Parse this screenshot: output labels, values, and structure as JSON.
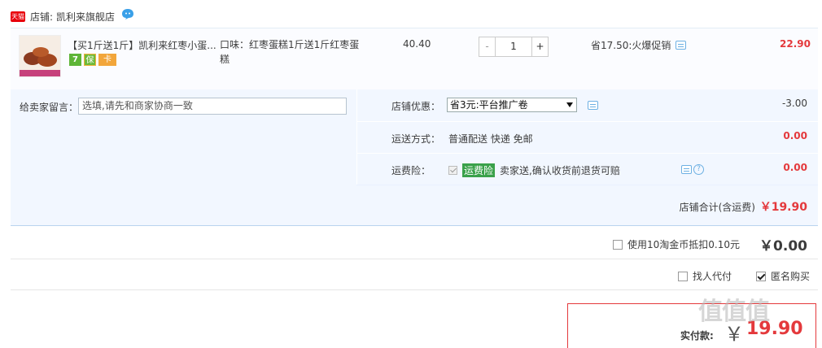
{
  "shop": {
    "badge": "天猫",
    "label": "店铺:",
    "name": "凯利来旗舰店"
  },
  "item": {
    "title": "【买1斤送1斤】凯利来红枣小蛋...",
    "sku_label": "口味：",
    "sku_value": "红枣蛋糕1斤送1斤红枣蛋糕",
    "service_icons": [
      "7",
      "保",
      "卡"
    ],
    "unit_price": "40.40",
    "quantity": {
      "minus": "-",
      "value": "1",
      "plus": "+"
    },
    "promo": "省17.50:火爆促销",
    "total": "22.90"
  },
  "message": {
    "label": "给卖家留言：",
    "placeholder": "选填,请先和商家协商一致"
  },
  "options": {
    "discount_label": "店铺优惠：",
    "discount_selected": "省3元:平台推广卷",
    "discount_value": "-3.00",
    "shipping_label": "运送方式：",
    "shipping_text": "普通配送 快递 免邮",
    "shipping_value": "0.00",
    "insurance_label": "运费险：",
    "insurance_badge": "运费险",
    "insurance_text": "卖家送,确认收货前退货可赔",
    "insurance_value": "0.00",
    "help_icon": "?"
  },
  "shop_total": {
    "label": "店铺合计(含运费)",
    "amount": "￥19.90"
  },
  "coins": {
    "label": "使用10淘金币抵扣0.10元",
    "amount": "￥0.00"
  },
  "pay_options": {
    "proxy_pay": "找人代付",
    "anonymous": "匿名购买"
  },
  "final": {
    "label": "实付款:",
    "yen": "￥",
    "amount": "19.90"
  },
  "watermark": "值值值",
  "colors": {
    "accent_red": "#e4393c",
    "bg_blue": "#f2f7ff",
    "insurance_green": "#3aa14a"
  }
}
